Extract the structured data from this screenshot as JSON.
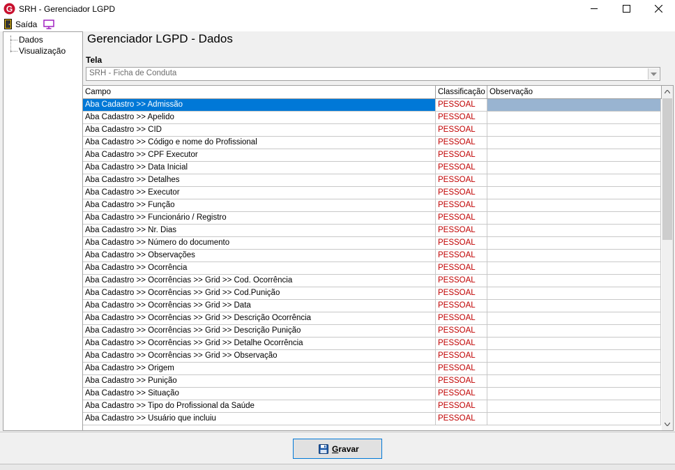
{
  "window": {
    "title": "SRH - Gerenciador LGPD"
  },
  "menu": {
    "exit_label": "Saída",
    "exit_icon": "exit-door-icon",
    "screen_icon": "monitor-icon"
  },
  "sidebar": {
    "items": [
      {
        "label": "Dados"
      },
      {
        "label": "Visualização"
      }
    ]
  },
  "main": {
    "heading": "Gerenciador LGPD - Dados",
    "tela_label": "Tela",
    "tela_value": "SRH - Ficha de Conduta"
  },
  "grid": {
    "columns": [
      "Campo",
      "Classificação",
      "Observação"
    ],
    "rows": [
      {
        "campo": "Aba Cadastro >> Admissão",
        "classificacao": "PESSOAL",
        "observacao": ""
      },
      {
        "campo": "Aba Cadastro >> Apelido",
        "classificacao": "PESSOAL",
        "observacao": ""
      },
      {
        "campo": "Aba Cadastro >> CID",
        "classificacao": "PESSOAL",
        "observacao": ""
      },
      {
        "campo": "Aba Cadastro >> Código e nome do Profissional",
        "classificacao": "PESSOAL",
        "observacao": ""
      },
      {
        "campo": "Aba Cadastro >> CPF Executor",
        "classificacao": "PESSOAL",
        "observacao": ""
      },
      {
        "campo": "Aba Cadastro >> Data Inicial",
        "classificacao": "PESSOAL",
        "observacao": ""
      },
      {
        "campo": "Aba Cadastro >> Detalhes",
        "classificacao": "PESSOAL",
        "observacao": ""
      },
      {
        "campo": "Aba Cadastro >> Executor",
        "classificacao": "PESSOAL",
        "observacao": ""
      },
      {
        "campo": "Aba Cadastro >> Função",
        "classificacao": "PESSOAL",
        "observacao": ""
      },
      {
        "campo": "Aba Cadastro >> Funcionário / Registro",
        "classificacao": "PESSOAL",
        "observacao": ""
      },
      {
        "campo": "Aba Cadastro >> Nr. Dias",
        "classificacao": "PESSOAL",
        "observacao": ""
      },
      {
        "campo": "Aba Cadastro >> Número do documento",
        "classificacao": "PESSOAL",
        "observacao": ""
      },
      {
        "campo": "Aba Cadastro >> Observações",
        "classificacao": "PESSOAL",
        "observacao": ""
      },
      {
        "campo": "Aba Cadastro >> Ocorrência",
        "classificacao": "PESSOAL",
        "observacao": ""
      },
      {
        "campo": "Aba Cadastro >> Ocorrências >> Grid >> Cod. Ocorrência",
        "classificacao": "PESSOAL",
        "observacao": ""
      },
      {
        "campo": "Aba Cadastro >> Ocorrências >> Grid >> Cod.Punição",
        "classificacao": "PESSOAL",
        "observacao": ""
      },
      {
        "campo": "Aba Cadastro >> Ocorrências >> Grid >> Data",
        "classificacao": "PESSOAL",
        "observacao": ""
      },
      {
        "campo": "Aba Cadastro >> Ocorrências >> Grid >> Descrição Ocorrência",
        "classificacao": "PESSOAL",
        "observacao": ""
      },
      {
        "campo": "Aba Cadastro >> Ocorrências >> Grid >> Descrição Punição",
        "classificacao": "PESSOAL",
        "observacao": ""
      },
      {
        "campo": "Aba Cadastro >> Ocorrências >> Grid >> Detalhe Ocorrência",
        "classificacao": "PESSOAL",
        "observacao": ""
      },
      {
        "campo": "Aba Cadastro >> Ocorrências >> Grid >> Observação",
        "classificacao": "PESSOAL",
        "observacao": ""
      },
      {
        "campo": "Aba Cadastro >> Origem",
        "classificacao": "PESSOAL",
        "observacao": ""
      },
      {
        "campo": "Aba Cadastro >> Punição",
        "classificacao": "PESSOAL",
        "observacao": ""
      },
      {
        "campo": "Aba Cadastro >> Situação",
        "classificacao": "PESSOAL",
        "observacao": ""
      },
      {
        "campo": "Aba Cadastro >> Tipo do Profissional da Saúde",
        "classificacao": "PESSOAL",
        "observacao": ""
      },
      {
        "campo": "Aba Cadastro >> Usuário que incluiu",
        "classificacao": "PESSOAL",
        "observacao": ""
      }
    ]
  },
  "footer": {
    "save_label_underlined": "G",
    "save_label_rest": "ravar",
    "save_icon": "floppy-disk-icon"
  },
  "colors": {
    "selection": "#0078d7",
    "classification": "#c00000",
    "accent": "#0078d7"
  }
}
